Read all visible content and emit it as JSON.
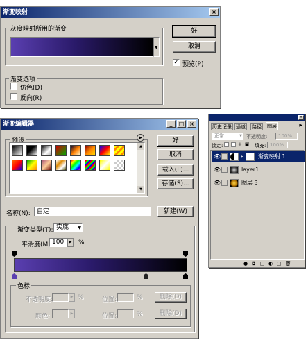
{
  "gradient_map": {
    "title": "渐变映射",
    "group_label": "灰度映射所用的渐变",
    "ok": "好",
    "cancel": "取消",
    "preview": "预览(P)",
    "preview_checked": true,
    "options_label": "渐变选项",
    "dither": "仿色(D)",
    "reverse": "反向(R)"
  },
  "gradient_editor": {
    "title": "渐变编辑器",
    "presets_label": "预设",
    "ok": "好",
    "cancel": "取消",
    "load": "载入(L)...",
    "save": "存储(S)...",
    "name_label": "名称(N):",
    "name_value": "自定",
    "new": "新建(W)",
    "type_label": "渐变类型(T):",
    "type_value": "实底",
    "smooth_label": "平滑度(M):",
    "smooth_value": "100",
    "smooth_unit": "%",
    "stops_label": "色标",
    "opacity_label": "不透明度:",
    "color_label": "颜色:",
    "pct": "%",
    "location_label": "位置:",
    "delete": "删除(D)"
  },
  "layers": {
    "tabs": [
      "历史记录",
      "通道",
      "路径",
      "图层"
    ],
    "blend_mode": "正常",
    "opacity_label": "不透明度:",
    "opacity_value": "100%",
    "lock_label": "锁定:",
    "fill_label": "填充:",
    "fill_value": "100%",
    "items": [
      {
        "name": "渐变映射 1",
        "selected": true
      },
      {
        "name": "layer1",
        "selected": false
      },
      {
        "name": "图层 3",
        "selected": false
      }
    ]
  },
  "colors": {
    "accent": "#0a246a",
    "gradient_start": "#5a3fb0",
    "gradient_end": "#000000"
  }
}
